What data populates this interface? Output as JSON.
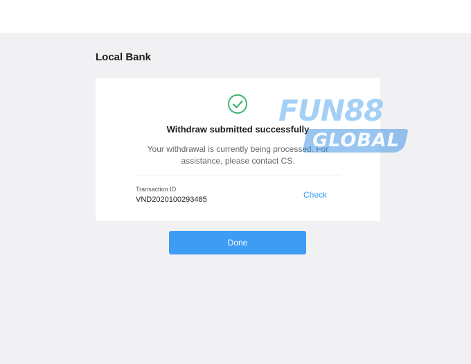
{
  "page": {
    "title": "Local Bank"
  },
  "result": {
    "icon": "check-circle-icon",
    "icon_color": "#3cb371",
    "title": "Withdraw submitted successfully",
    "message": "Your withdrawal is currently being processed. For assistance, please contact CS."
  },
  "transaction": {
    "label": "Transaction ID",
    "value": "VND2020100293485",
    "check_label": "Check"
  },
  "actions": {
    "done_label": "Done"
  },
  "watermark": {
    "line1": "FUN88",
    "line2": "GLOBAL"
  },
  "colors": {
    "accent": "#3f9cf5",
    "link": "#3a9af6",
    "success": "#3cb371",
    "background": "#f1f1f3"
  }
}
